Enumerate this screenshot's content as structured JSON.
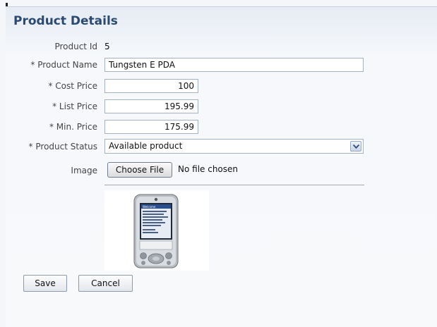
{
  "page": {
    "title": "Product Details"
  },
  "form": {
    "product_id": {
      "label": "Product Id",
      "value": "5"
    },
    "product_name": {
      "label": "Product Name",
      "value": "Tungsten E PDA"
    },
    "cost_price": {
      "label": "Cost Price",
      "value": "100"
    },
    "list_price": {
      "label": "List Price",
      "value": "195.99"
    },
    "min_price": {
      "label": "Min. Price",
      "value": "175.99"
    },
    "product_status": {
      "label": "Product Status",
      "value": "Available product"
    },
    "image": {
      "label": "Image",
      "button": "Choose File",
      "status": "No file chosen"
    },
    "required_mark": "*"
  },
  "pda_screen": {
    "header": "Welcome",
    "lines": [
      "Welcome",
      "Where to start",
      "Tour",
      "Open files",
      "Sync",
      "Settings"
    ]
  },
  "actions": {
    "save": "Save",
    "cancel": "Cancel"
  },
  "colors": {
    "title": "#2b4a73",
    "panel_top": "#e6ecf4",
    "border": "#a3b1c2"
  }
}
